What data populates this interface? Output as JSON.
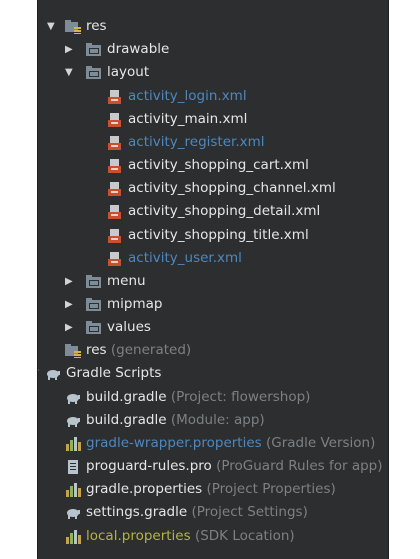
{
  "tree": {
    "res": {
      "label": "res"
    },
    "drawable": {
      "label": "drawable"
    },
    "layout": {
      "label": "layout"
    },
    "layout_files": [
      {
        "label": "activity_login.xml"
      },
      {
        "label": "activity_main.xml"
      },
      {
        "label": "activity_register.xml"
      },
      {
        "label": "activity_shopping_cart.xml"
      },
      {
        "label": "activity_shopping_channel.xml"
      },
      {
        "label": "activity_shopping_detail.xml"
      },
      {
        "label": "activity_shopping_title.xml"
      },
      {
        "label": "activity_user.xml"
      }
    ],
    "menu": {
      "label": "menu"
    },
    "mipmap": {
      "label": "mipmap"
    },
    "values": {
      "label": "values"
    },
    "res_generated": {
      "label": "res",
      "hint": "(generated)"
    },
    "gradle_scripts": {
      "label": "Gradle Scripts"
    },
    "scripts": [
      {
        "label": "build.gradle",
        "hint": "(Project: flowershop)"
      },
      {
        "label": "build.gradle",
        "hint": "(Module: app)"
      },
      {
        "label": "gradle-wrapper.properties",
        "hint": "(Gradle Version)"
      },
      {
        "label": "proguard-rules.pro",
        "hint": "(ProGuard Rules for app)"
      },
      {
        "label": "gradle.properties",
        "hint": "(Project Properties)"
      },
      {
        "label": "settings.gradle",
        "hint": "(Project Settings)"
      },
      {
        "label": "local.properties",
        "hint": "(SDK Location)"
      }
    ]
  },
  "glyphs": {
    "expanded": "▼",
    "collapsed": "▶"
  },
  "colors": {
    "background": "#2c2e30",
    "text": "#e6e6e6",
    "modified_blue": "#4f88bd",
    "hint_gray": "#7d8183",
    "ignored_olive": "#b5b53e",
    "folder": "#7d8c96",
    "xml_icon": "#c6502f",
    "gradle_icon": "#b8c4cc"
  }
}
